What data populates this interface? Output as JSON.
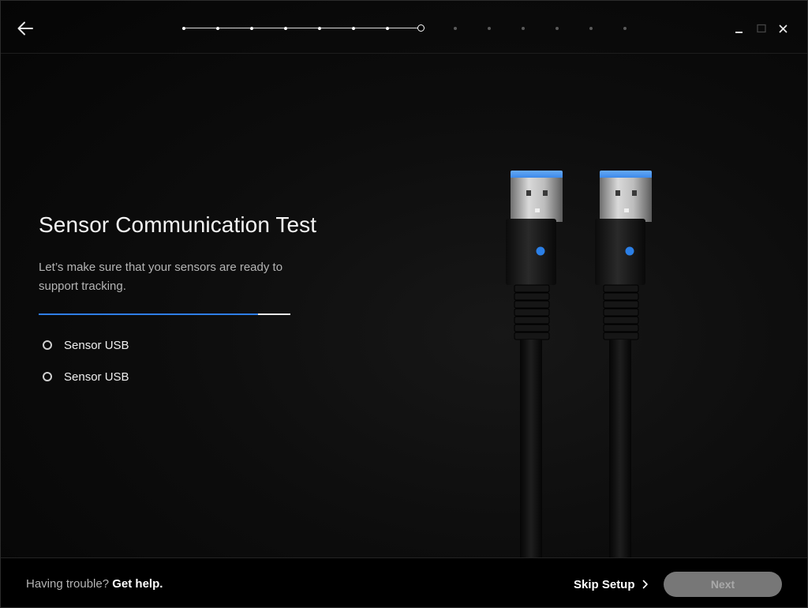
{
  "window": {
    "controls": {
      "minimize_icon": "minimize-icon",
      "maximize_icon": "maximize-icon",
      "close_icon": "close-icon"
    }
  },
  "header": {
    "back_icon": "back-arrow-icon",
    "stepper": {
      "total_steps": 14,
      "completed_steps": 7,
      "current_step": 8
    }
  },
  "main": {
    "title": "Sensor Communication Test",
    "subtitle": "Let’s make sure that your sensors are ready to support tracking.",
    "progress": 0.87,
    "sensors": [
      {
        "label": "Sensor USB"
      },
      {
        "label": "Sensor USB"
      }
    ]
  },
  "illustration": {
    "subject": "two USB connectors",
    "led_color": "#2b7fe6",
    "usb_tongue_color": "#3a8cef"
  },
  "footer": {
    "help_prefix": "Having trouble?",
    "help_link": "Get help.",
    "skip_label": "Skip Setup",
    "skip_icon": "chevron-right-icon",
    "next_label": "Next"
  }
}
